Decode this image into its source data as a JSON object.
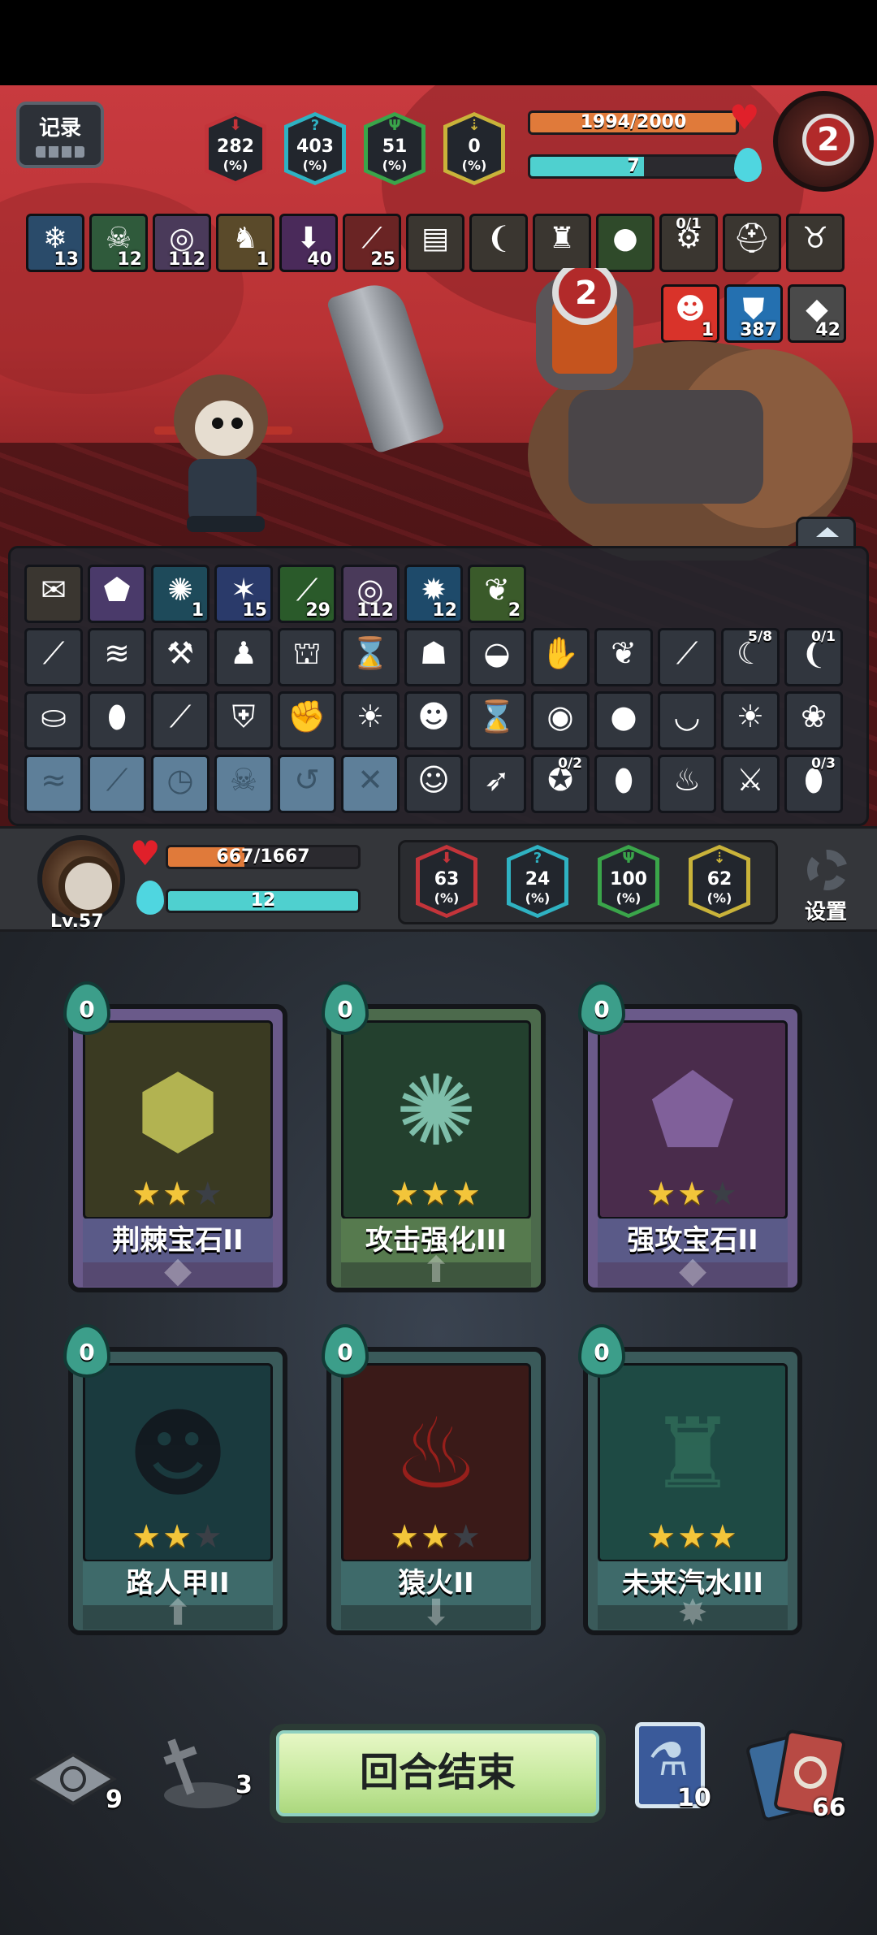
{
  "header": {
    "record_label": "记录"
  },
  "enemy": {
    "hp_text": "1994/2000",
    "hp_fraction": 0.997,
    "energy_text": "7",
    "energy_fraction": 0.55,
    "portrait_number": "2",
    "stats": [
      {
        "value": "282",
        "unit": "(%)",
        "color": "#c3343a",
        "icon": "sword-icon"
      },
      {
        "value": "403",
        "unit": "(%)",
        "color": "#2fb2c2",
        "icon": "question-icon"
      },
      {
        "value": "51",
        "unit": "(%)",
        "color": "#3aa54a",
        "icon": "trident-icon"
      },
      {
        "value": "0",
        "unit": "(%)",
        "color": "#c9b33a",
        "icon": "arrow-down-icon"
      }
    ],
    "buffs_row1": [
      {
        "icon": "snowflake-icon",
        "glyph": "❄",
        "count": "13",
        "bg": "#2a4b6a"
      },
      {
        "icon": "skull-icon",
        "glyph": "☠",
        "count": "12",
        "bg": "#2f5a3b"
      },
      {
        "icon": "spiral-icon",
        "glyph": "◎",
        "count": "112",
        "bg": "#4a3a5a"
      },
      {
        "icon": "horn-icon",
        "glyph": "♞",
        "count": "1",
        "bg": "#5a4a2a"
      },
      {
        "icon": "figure-down-icon",
        "glyph": "⬇",
        "count": "40",
        "bg": "#4a2a5a"
      },
      {
        "icon": "claw-icon",
        "glyph": "⟋",
        "count": "25",
        "bg": "#6a2424"
      },
      {
        "icon": "book-icon",
        "glyph": "▤",
        "count": "",
        "bg": "#3a3630"
      },
      {
        "icon": "fang-icon",
        "glyph": "❨",
        "count": "",
        "bg": "#3a3630"
      },
      {
        "icon": "statue-icon",
        "glyph": "♜",
        "count": "",
        "bg": "#3a3630"
      },
      {
        "icon": "slime-icon",
        "glyph": "●",
        "count": "",
        "bg": "#2f4a2a"
      },
      {
        "icon": "spike-ring-icon",
        "glyph": "⚙",
        "count": "",
        "top": "0/1",
        "bg": "#3a3630"
      },
      {
        "icon": "helmet-icon",
        "glyph": "⛑",
        "count": "",
        "bg": "#3a3630"
      },
      {
        "icon": "horns-icon",
        "glyph": "♉",
        "count": "",
        "bg": "#3a3630"
      }
    ],
    "buffs_row2": [
      {
        "icon": "demon-face-icon",
        "glyph": "☻",
        "count": "1",
        "bg": "#d9332a"
      },
      {
        "icon": "shield-icon",
        "glyph": "⛊",
        "count": "387",
        "bg": "#2470b0"
      },
      {
        "icon": "rock-icon",
        "glyph": "◆",
        "count": "42",
        "bg": "#4a4a4a"
      }
    ]
  },
  "relics": {
    "row1": [
      {
        "icon": "scroll-icon",
        "glyph": "✉",
        "count": "",
        "bg": "#3a3630"
      },
      {
        "icon": "purple-gem-icon",
        "glyph": "⬟",
        "count": "",
        "bg": "#4a3a6a"
      },
      {
        "icon": "cyan-swirl-icon",
        "glyph": "✺",
        "count": "1",
        "bg": "#1e4a5a"
      },
      {
        "icon": "lightning-icon",
        "glyph": "✶",
        "count": "15",
        "bg": "#2a3a6a"
      },
      {
        "icon": "green-slash-icon",
        "glyph": "⟋",
        "count": "29",
        "bg": "#2a5a2a"
      },
      {
        "icon": "spiral-icon",
        "glyph": "◎",
        "count": "112",
        "bg": "#4a3a5a"
      },
      {
        "icon": "blue-burst-icon",
        "glyph": "✹",
        "count": "12",
        "bg": "#1e4a6a"
      },
      {
        "icon": "green-bottle-icon",
        "glyph": "❦",
        "count": "2",
        "bg": "#3a5a2a"
      }
    ],
    "row2": [
      {
        "icon": "blue-feather-icon",
        "glyph": "⟋",
        "count": ""
      },
      {
        "icon": "bandage-icon",
        "glyph": "≋",
        "count": ""
      },
      {
        "icon": "hammer-icon",
        "glyph": "⚒",
        "count": ""
      },
      {
        "icon": "bomb-icon",
        "glyph": "♟",
        "count": ""
      },
      {
        "icon": "barrel-icon",
        "glyph": "⛫",
        "count": ""
      },
      {
        "icon": "hourglass-icon",
        "glyph": "⌛",
        "count": ""
      },
      {
        "icon": "vest-icon",
        "glyph": "☗",
        "count": ""
      },
      {
        "icon": "wallet-icon",
        "glyph": "◒",
        "count": ""
      },
      {
        "icon": "glove-icon",
        "glyph": "✋",
        "count": ""
      },
      {
        "icon": "wings-icon",
        "glyph": "❦",
        "count": ""
      },
      {
        "icon": "wand-icon",
        "glyph": "⟋",
        "count": ""
      },
      {
        "icon": "dagger-icon",
        "glyph": "☾",
        "count": "",
        "top": "5/8"
      },
      {
        "icon": "boomerang-icon",
        "glyph": "❨",
        "count": "",
        "top": "0/1"
      }
    ],
    "row3": [
      {
        "icon": "pot-icon",
        "glyph": "⛀",
        "count": ""
      },
      {
        "icon": "egg-icon",
        "glyph": "⬮",
        "count": ""
      },
      {
        "icon": "bone-icon",
        "glyph": "⟋",
        "count": ""
      },
      {
        "icon": "armor-icon",
        "glyph": "⛨",
        "count": ""
      },
      {
        "icon": "mitt-icon",
        "glyph": "✊",
        "count": ""
      },
      {
        "icon": "fire-orb-icon",
        "glyph": "☀",
        "count": ""
      },
      {
        "icon": "owl-icon",
        "glyph": "☻",
        "count": ""
      },
      {
        "icon": "green-hourglass-icon",
        "glyph": "⌛",
        "count": ""
      },
      {
        "icon": "blue-rune-icon",
        "glyph": "◉",
        "count": ""
      },
      {
        "icon": "seed-bag-icon",
        "glyph": "●",
        "count": ""
      },
      {
        "icon": "green-bowl-icon",
        "glyph": "◡",
        "count": ""
      },
      {
        "icon": "flame-egg-icon",
        "glyph": "☀",
        "count": ""
      },
      {
        "icon": "leafy-head-icon",
        "glyph": "❀",
        "count": ""
      }
    ],
    "row4": [
      {
        "icon": "locked-wave-icon",
        "glyph": "≈",
        "locked": true,
        "count": ""
      },
      {
        "icon": "locked-dial-icon",
        "glyph": "⟋",
        "locked": true,
        "count": ""
      },
      {
        "icon": "locked-clock-icon",
        "glyph": "◷",
        "locked": true,
        "count": ""
      },
      {
        "icon": "locked-skull-icon",
        "glyph": "☠",
        "locked": true,
        "count": ""
      },
      {
        "icon": "locked-arrows-icon",
        "glyph": "↺",
        "locked": true,
        "count": ""
      },
      {
        "icon": "locked-pistols-icon",
        "glyph": "✕",
        "locked": true,
        "count": ""
      },
      {
        "icon": "doll-icon",
        "glyph": "☺",
        "count": ""
      },
      {
        "icon": "kunai-icon",
        "glyph": "➶",
        "count": ""
      },
      {
        "icon": "mace-icon",
        "glyph": "✪",
        "count": "",
        "top": "0/2"
      },
      {
        "icon": "blue-egg-icon",
        "glyph": "⬮",
        "count": ""
      },
      {
        "icon": "red-jar-icon",
        "glyph": "♨",
        "count": ""
      },
      {
        "icon": "claw-trap-icon",
        "glyph": "⚔",
        "count": ""
      },
      {
        "icon": "ruby-egg-icon",
        "glyph": "⬮",
        "count": "",
        "top": "0/3"
      }
    ]
  },
  "player": {
    "level": "Lv.57",
    "hp_text": "667/1667",
    "hp_fraction": 0.4,
    "energy_text": "12",
    "energy_fraction": 1.0,
    "stats": [
      {
        "value": "63",
        "unit": "(%)",
        "color": "#c3343a",
        "icon": "sword-icon"
      },
      {
        "value": "24",
        "unit": "(%)",
        "color": "#2fb2c2",
        "icon": "question-icon"
      },
      {
        "value": "100",
        "unit": "(%)",
        "color": "#3aa54a",
        "icon": "trident-icon"
      },
      {
        "value": "62",
        "unit": "(%)",
        "color": "#c9b33a",
        "icon": "arrow-down-icon"
      }
    ],
    "settings_label": "设置"
  },
  "cards": [
    {
      "name": "荆棘宝石II",
      "cost": "0",
      "stars": 2,
      "frame": "#6a5a8a",
      "band": "#5a5a88",
      "art": "#3a3a22",
      "glyph": "⬢",
      "glyph_color": "#c7c95a",
      "foot_icon": "gem-icon",
      "foot_glyph": "◆"
    },
    {
      "name": "攻击强化III",
      "cost": "0",
      "stars": 3,
      "frame": "#4c6a4c",
      "band": "#567a4e",
      "art": "#23402e",
      "glyph": "✺",
      "glyph_color": "#8fd4c0",
      "foot_icon": "up-arrow-icon",
      "foot_glyph": "⬆"
    },
    {
      "name": "强攻宝石II",
      "cost": "0",
      "stars": 2,
      "frame": "#6a5a8a",
      "band": "#5a5a88",
      "art": "#4a2c4c",
      "glyph": "⬟",
      "glyph_color": "#8a6aa8",
      "foot_icon": "gem-icon",
      "foot_glyph": "◆"
    },
    {
      "name": "路人甲II",
      "cost": "0",
      "stars": 2,
      "frame": "#3a5a5a",
      "band": "#3e6a6a",
      "art": "#1a3a3e",
      "glyph": "☻",
      "glyph_color": "#12161c",
      "foot_icon": "up-arrow-icon",
      "foot_glyph": "⬆"
    },
    {
      "name": "猿火II",
      "cost": "0",
      "stars": 2,
      "frame": "#3a5a5a",
      "band": "#3e6a6a",
      "art": "#3a1a18",
      "glyph": "♨",
      "glyph_color": "#a8201c",
      "foot_icon": "down-arrow-icon",
      "foot_glyph": "⬇"
    },
    {
      "name": "未来汽水III",
      "cost": "0",
      "stars": 3,
      "frame": "#3a5a5a",
      "band": "#3e6a6a",
      "art": "#1e4a44",
      "glyph": "♜",
      "glyph_color": "#2f6a58",
      "foot_icon": "sparkle-icon",
      "foot_glyph": "✸"
    }
  ],
  "bottom": {
    "end_turn_label": "回合结束",
    "draw_pile_count": "9",
    "grave_count": "3",
    "potion_count": "10",
    "discard_count": "66"
  }
}
